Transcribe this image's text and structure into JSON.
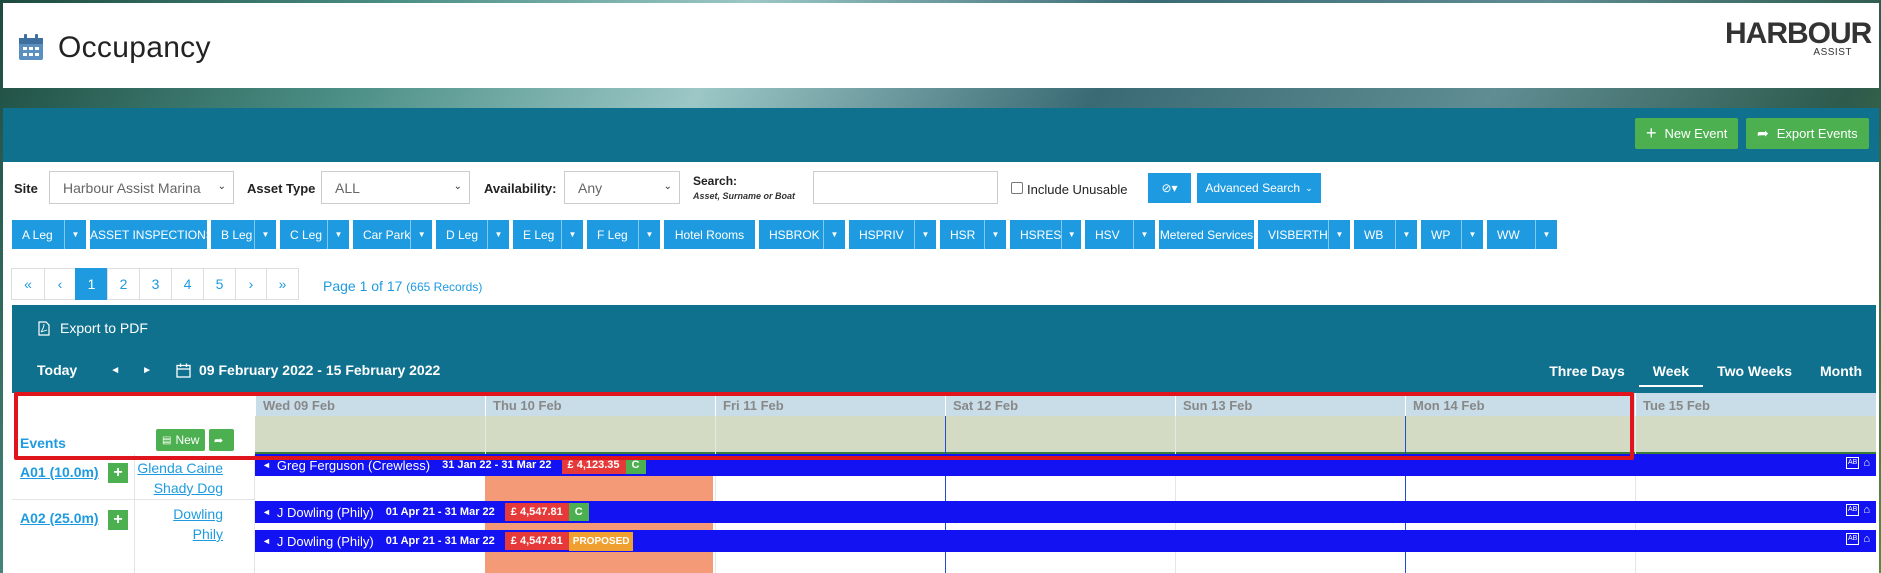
{
  "header": {
    "title": "Occupancy",
    "logo_text": "HARBOUR",
    "logo_sub": "ASSIST"
  },
  "toolbar": {
    "new_event": "New Event",
    "export_events": "Export Events"
  },
  "filters": {
    "site_label": "Site",
    "site_value": "Harbour Assist Marina",
    "asset_type_label": "Asset Type",
    "asset_type_value": "ALL",
    "availability_label": "Availability:",
    "availability_value": "Any",
    "search_label": "Search:",
    "search_hint": "Asset, Surname or Boat",
    "include_unusable": "Include Unusable",
    "advanced_search": "Advanced Search"
  },
  "asset_chips": [
    {
      "label": "A Leg",
      "dd": true
    },
    {
      "label": "ASSET INSPECTIONS",
      "dd": false
    },
    {
      "label": "B Leg",
      "dd": true
    },
    {
      "label": "C Leg",
      "dd": true
    },
    {
      "label": "Car Park",
      "dd": true
    },
    {
      "label": "D Leg",
      "dd": true
    },
    {
      "label": "E Leg",
      "dd": true
    },
    {
      "label": "F Leg",
      "dd": true
    },
    {
      "label": "Hotel Rooms",
      "dd": false
    },
    {
      "label": "HSBROK",
      "dd": true
    },
    {
      "label": "HSPRIV",
      "dd": true
    },
    {
      "label": "HSR",
      "dd": true
    },
    {
      "label": "HSRES",
      "dd": true
    },
    {
      "label": "HSV",
      "dd": true
    },
    {
      "label": "Metered Services",
      "dd": false
    },
    {
      "label": "VISBERTH",
      "dd": true
    },
    {
      "label": "WB",
      "dd": true
    },
    {
      "label": "WP",
      "dd": true
    },
    {
      "label": "WW",
      "dd": true
    }
  ],
  "pager": {
    "items": [
      "«",
      "‹",
      "1",
      "2",
      "3",
      "4",
      "5",
      "›",
      "»"
    ],
    "active": "1",
    "info": "Page 1 of 17",
    "records": "(665 Records)"
  },
  "schedule": {
    "export_pdf": "Export to PDF",
    "today": "Today",
    "prev": "◄",
    "next": "►",
    "range": "09 February 2022 - 15 February 2022",
    "views": [
      "Three Days",
      "Week",
      "Two Weeks",
      "Month"
    ],
    "active_view": "Week",
    "days": [
      "Wed 09 Feb",
      "Thu 10 Feb",
      "Fri 11 Feb",
      "Sat 12 Feb",
      "Sun 13 Feb",
      "Mon 14 Feb",
      "Tue 15 Feb"
    ],
    "events_label": "Events",
    "new_label": "New",
    "assets": [
      {
        "code": "A01 (10.0m)",
        "owner1": "Glenda Caine",
        "owner2": "Shady Dog"
      },
      {
        "code": "A02 (25.0m)",
        "owner1": "Dowling",
        "owner2": "Phily"
      }
    ],
    "bookings": [
      {
        "name": "Greg Ferguson (Crewless)",
        "dates": "31 Jan 22 - 31 Mar 22",
        "price": "£ 4,123.35",
        "status": "C"
      },
      {
        "name": "J Dowling (Phily)",
        "dates": "01 Apr 21 - 31 Mar 22",
        "price": "£ 4,547.81",
        "status": "C"
      },
      {
        "name": "J Dowling (Phily)",
        "dates": "01 Apr 21 - 31 Mar 22",
        "price": "£ 4,547.81",
        "status": "PROPOSED"
      }
    ],
    "icons": {
      "ab": "AB"
    }
  },
  "colors": {
    "primary": "#10718f",
    "accent": "#1e9be0",
    "green": "#4cb050",
    "booking": "#1212f2",
    "price": "#e63a3a",
    "proposed": "#f0a030",
    "highlight": "#e0141c"
  }
}
